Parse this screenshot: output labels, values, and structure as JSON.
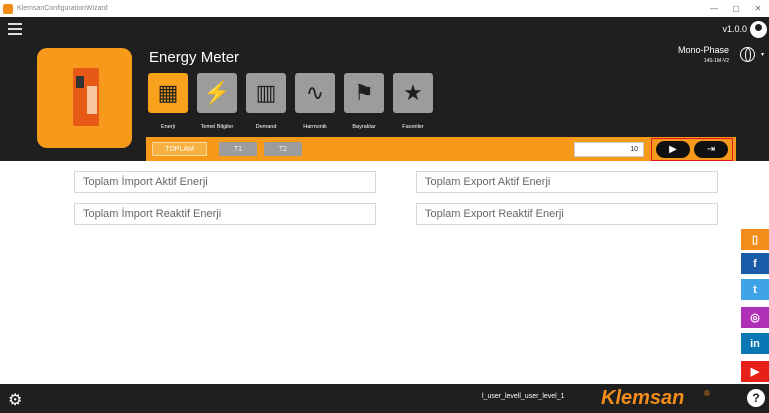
{
  "window": {
    "title": "KlemsanConfigurationWizard",
    "min": "—",
    "max": "▢",
    "close": "✕"
  },
  "header": {
    "version": "v1.0.0",
    "title": "Energy Meter",
    "phase": "Mono-Phase",
    "model": "14S-1M-V2"
  },
  "nav": {
    "items": [
      {
        "label": "Enerji",
        "icon": "energy-meter-icon"
      },
      {
        "label": "Temel Bilgiler",
        "icon": "power-tower-icon"
      },
      {
        "label": "Demand",
        "icon": "demand-chart-icon"
      },
      {
        "label": "Harmonik",
        "icon": "harmonic-wave-icon"
      },
      {
        "label": "Bayraklar",
        "icon": "flags-icon"
      },
      {
        "label": "Favoriler",
        "icon": "star-icon"
      }
    ]
  },
  "tabs": {
    "toplam": "TOPLAM",
    "t1": "T1",
    "t2": "T2"
  },
  "toolbar": {
    "count_value": "10"
  },
  "fields": {
    "import_active": "Toplam İmport Aktif Enerji",
    "export_active": "Toplam Export Aktif Enerji",
    "import_reactive": "Toplam İmport Reaktif Enerji",
    "export_reactive": "Toplam Export Reaktif Enerji"
  },
  "footer": {
    "user_level": "l_user_levell_user_level_1",
    "brand": "Klemsan",
    "reg": "®",
    "help": "?"
  },
  "colors": {
    "accent": "#f79a1c",
    "dark": "#1f1f1f",
    "highlight": "#e0181b"
  }
}
